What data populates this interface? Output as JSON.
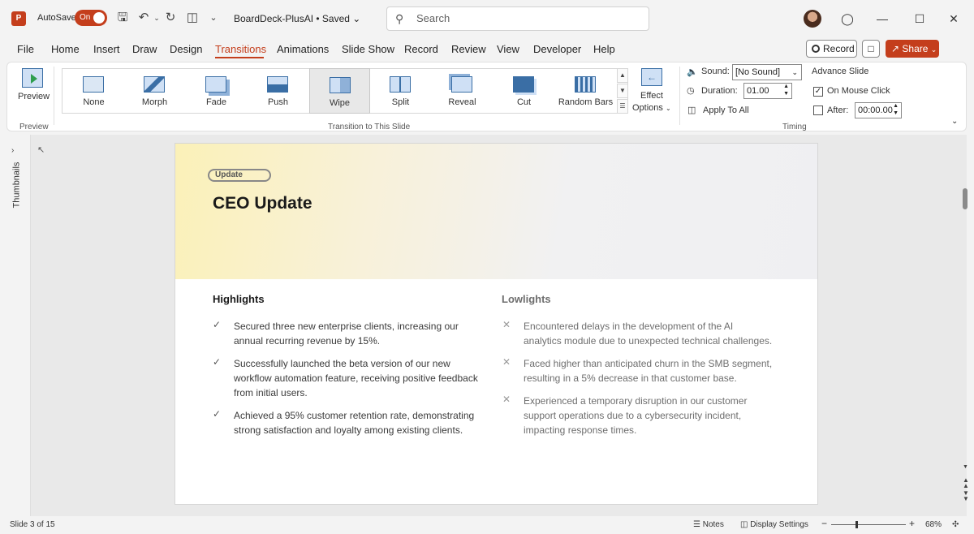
{
  "titlebar": {
    "app_logo": "P",
    "autosave_label": "AutoSave",
    "autosave_state": "On",
    "doc_title": "BoardDeck-PlusAI • Saved",
    "search_placeholder": "Search",
    "icons": [
      "save-icon",
      "undo-icon",
      "redo-icon",
      "present-icon",
      "customize-icon"
    ]
  },
  "menu": {
    "tabs": [
      "File",
      "Home",
      "Insert",
      "Draw",
      "Design",
      "Transitions",
      "Animations",
      "Slide Show",
      "Record",
      "Review",
      "View",
      "Developer",
      "Help"
    ],
    "active_tab": "Transitions",
    "record_label": "Record",
    "share_label": "Share"
  },
  "ribbon": {
    "preview_label": "Preview",
    "preview_group": "Preview",
    "transitions": [
      "None",
      "Morph",
      "Fade",
      "Push",
      "Wipe",
      "Split",
      "Reveal",
      "Cut",
      "Random Bars"
    ],
    "selected_transition": "Wipe",
    "transition_group": "Transition to This Slide",
    "effect_options_line1": "Effect",
    "effect_options_line2": "Options",
    "sound_label": "Sound:",
    "sound_value": "[No Sound]",
    "duration_label": "Duration:",
    "duration_value": "01.00",
    "apply_all_label": "Apply To All",
    "advance_title": "Advance Slide",
    "on_mouse_click_label": "On Mouse Click",
    "on_mouse_click_checked": true,
    "after_label": "After:",
    "after_value": "00:00.00",
    "timing_group": "Timing"
  },
  "sidepane": {
    "thumbnails_label": "Thumbnails"
  },
  "slide": {
    "badge": "Update",
    "title": "CEO Update",
    "highlights_title": "Highlights",
    "highlights": [
      [
        "Secured three new enterprise clients, increasing our",
        "annual recurring revenue by 15%."
      ],
      [
        "Successfully launched the beta version of our new",
        "workflow automation feature, receiving positive feedback",
        "from initial users."
      ],
      [
        "Achieved a 95% customer retention rate, demonstrating",
        "strong satisfaction and loyalty among existing clients."
      ]
    ],
    "lowlights_title": "Lowlights",
    "lowlights": [
      [
        "Encountered delays in the development of the AI",
        "analytics module due to unexpected technical challenges."
      ],
      [
        "Faced higher than anticipated churn in the SMB segment,",
        "resulting in a 5% decrease in that customer base."
      ],
      [
        "Experienced a temporary disruption in our customer",
        "support operations due to a cybersecurity incident,",
        "impacting response times."
      ]
    ]
  },
  "status": {
    "slide_counter": "Slide 3 of 15",
    "notes_label": "Notes",
    "display_settings_label": "Display Settings",
    "zoom_minus": "−",
    "zoom_plus": "+",
    "zoom_value": "68%"
  }
}
